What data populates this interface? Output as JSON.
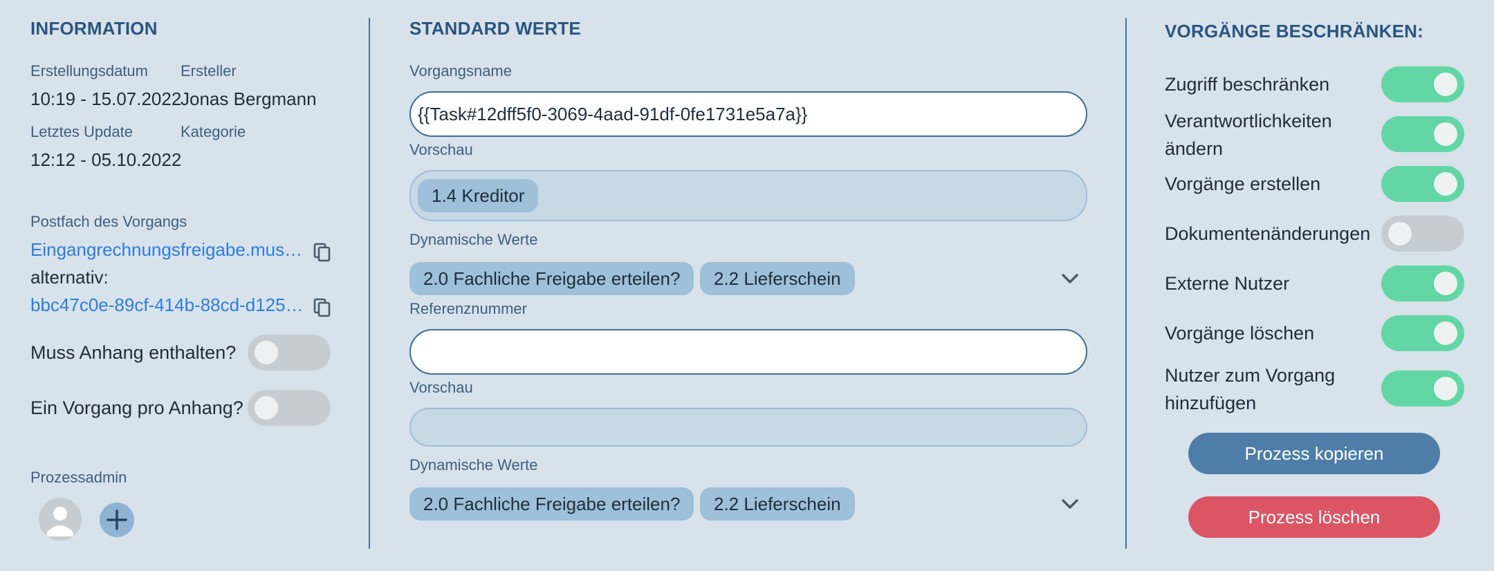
{
  "information": {
    "title": "INFORMATION",
    "created_label": "Erstellungsdatum",
    "created_value": "10:19 - 15.07.2022",
    "creator_label": "Ersteller",
    "creator_value": "Jonas Bergmann",
    "updated_label": "Letztes Update",
    "updated_value": "12:12 - 05.10.2022",
    "category_label": "Kategorie",
    "category_value": "",
    "mailbox_label": "Postfach des Vorgangs",
    "mailbox_value": "Eingangrechnungsfreigabe.mus…",
    "alternative_label": "alternativ:",
    "alternative_value": "bbc47c0e-89cf-414b-88cd-d125…",
    "attachment_required_label": "Muss Anhang enthalten?",
    "attachment_required_on": false,
    "one_per_attachment_label": "Ein Vorgang pro Anhang?",
    "one_per_attachment_on": false,
    "process_admin_label": "Prozessadmin"
  },
  "standard": {
    "title": "STANDARD WERTE",
    "name_label": "Vorgangsname",
    "name_value": "{{Task#12dff5f0-3069-4aad-91df-0fe1731e5a7a}}",
    "preview1_label": "Vorschau",
    "preview1_chip": "1.4 Kreditor",
    "dynamic1_label": "Dynamische Werte",
    "dynamic1_chips": [
      "2.0 Fachliche Freigabe erteilen?",
      "2.2 Lieferschein"
    ],
    "reference_label": "Referenznummer",
    "reference_value": "",
    "preview2_label": "Vorschau",
    "dynamic2_label": "Dynamische Werte",
    "dynamic2_chips": [
      "2.0 Fachliche Freigabe erteilen?",
      "2.2 Lieferschein"
    ]
  },
  "restrict": {
    "title": "VORGÄNGE BESCHRÄNKEN:",
    "items": [
      {
        "label": "Zugriff beschränken",
        "on": true
      },
      {
        "label": "Verantwortlichkeiten ändern",
        "on": true
      },
      {
        "label": "Vorgänge erstellen",
        "on": true
      },
      {
        "label": "Dokumentenänderungen",
        "on": false
      },
      {
        "label": "Externe Nutzer",
        "on": true
      },
      {
        "label": "Vorgänge löschen",
        "on": true
      },
      {
        "label": "Nutzer zum Vorgang hinzufügen",
        "on": true
      }
    ],
    "copy_button": "Prozess kopieren",
    "delete_button": "Prozess löschen"
  },
  "colors": {
    "background": "#d7e2eb",
    "accent_blue": "#4e7ea7",
    "danger_red": "#dc5565",
    "toggle_on": "#62d6a4",
    "toggle_off": "#c6cdd2",
    "link": "#2e7ddb"
  }
}
